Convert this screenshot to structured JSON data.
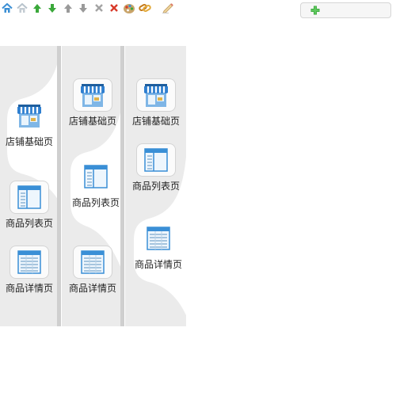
{
  "toolbar": {
    "icons": [
      "home-icon",
      "home-disabled-icon",
      "arrow-up-green-icon",
      "arrow-down-green-icon",
      "arrow-up-gray-icon",
      "arrow-down-gray-icon",
      "delete-gray-icon",
      "delete-red-icon",
      "palette-icon",
      "link-icon",
      "edit-icon"
    ],
    "add_icon": "plus-icon"
  },
  "columns": [
    {
      "items": [
        {
          "label": "店铺基础页",
          "icon": "shop-icon",
          "selected": true
        },
        {
          "label": "商品列表页",
          "icon": "list-page-icon",
          "selected": false
        },
        {
          "label": "商品详情页",
          "icon": "detail-page-icon",
          "selected": false
        }
      ]
    },
    {
      "items": [
        {
          "label": "店铺基础页",
          "icon": "shop-icon",
          "selected": false
        },
        {
          "label": "商品列表页",
          "icon": "list-page-icon",
          "selected": true
        },
        {
          "label": "商品详情页",
          "icon": "detail-page-icon",
          "selected": false
        }
      ]
    },
    {
      "items": [
        {
          "label": "店铺基础页",
          "icon": "shop-icon",
          "selected": false
        },
        {
          "label": "商品列表页",
          "icon": "list-page-icon",
          "selected": false
        },
        {
          "label": "商品详情页",
          "icon": "detail-page-icon",
          "selected": true
        }
      ]
    }
  ],
  "colors": {
    "column_bg": "#ebebeb",
    "selected_bg": "#ffffff",
    "awning_blue": "#2f7fd0",
    "page_blue": "#3a8fd6",
    "arrow_green": "#3aa83a",
    "delete_red": "#d83a2a"
  }
}
